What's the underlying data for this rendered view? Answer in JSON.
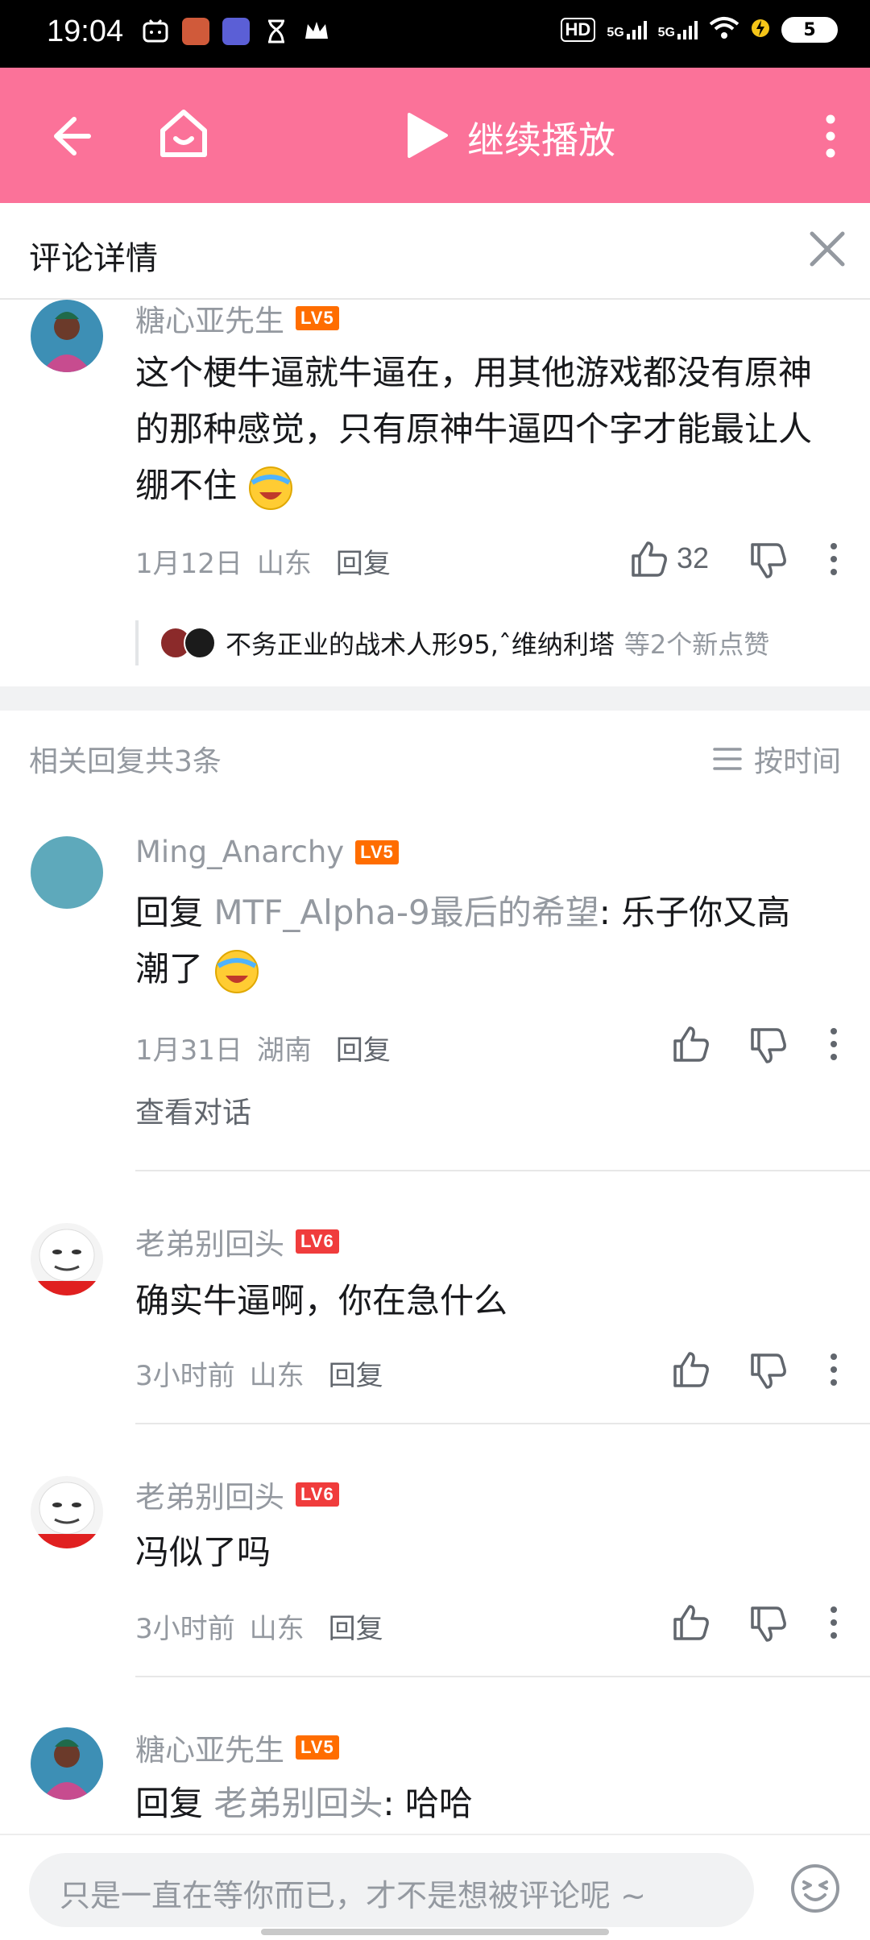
{
  "status_bar": {
    "time": "19:04",
    "net1": "5G",
    "net2": "5G",
    "hd": "HD",
    "battery": "5"
  },
  "topbar": {
    "title": "继续播放",
    "accent": "#fb7299"
  },
  "detail": {
    "title": "评论详情"
  },
  "root_comment": {
    "user": "糖心亚先生",
    "level": "LV5",
    "text": "这个梗牛逼就牛逼在，用其他游戏都没有原神的那种感觉，只有原神牛逼四个字才能最让人绷不住",
    "date": "1月12日",
    "location": "山东",
    "reply_label": "回复",
    "likes": "32",
    "liked_by": "不务正业的战术人形95,ˆ维纳利塔",
    "liked_more": "等2个新点赞"
  },
  "replies_header": {
    "count_text": "相关回复共3条",
    "sort_label": "按时间"
  },
  "replies": [
    {
      "user": "Ming_Anarchy",
      "level": "LV5",
      "prefix": "回复 ",
      "ref": "MTF_Alpha-9最后的希望",
      "text_line1": ": 乐子你又高",
      "text_line2": "潮了",
      "date": "1月31日",
      "location": "湖南",
      "reply_label": "回复",
      "view_conversation": "查看对话"
    },
    {
      "user": "老弟别回头",
      "level": "LV6",
      "text": "确实牛逼啊，你在急什么",
      "date": "3小时前",
      "location": "山东",
      "reply_label": "回复"
    },
    {
      "user": "老弟别回头",
      "level": "LV6",
      "text": "冯似了吗",
      "date": "3小时前",
      "location": "山东",
      "reply_label": "回复"
    },
    {
      "user": "糖心亚先生",
      "level": "LV5",
      "prefix": "回复 ",
      "ref": "老弟别回头",
      "text": ": 哈哈"
    }
  ],
  "input": {
    "placeholder": "只是一直在等你而已，才不是想被评论呢 ~"
  }
}
